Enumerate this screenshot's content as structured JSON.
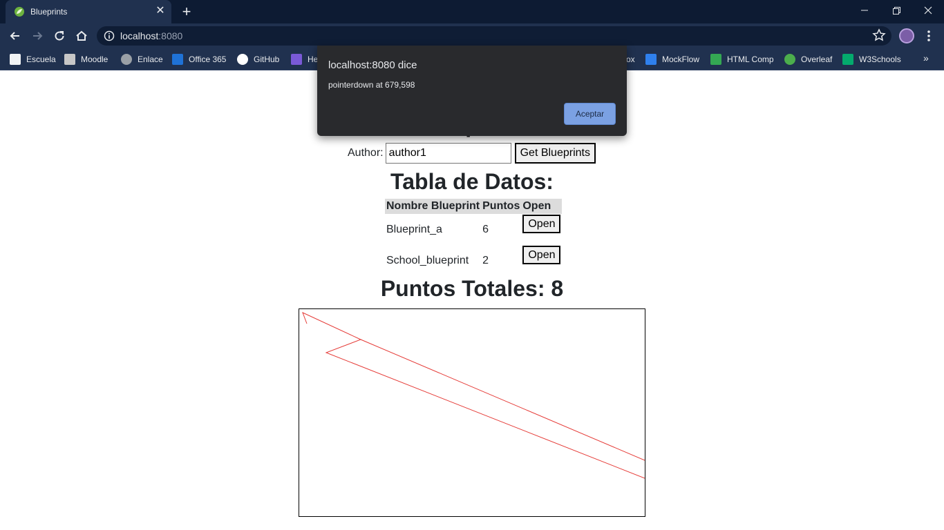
{
  "browser": {
    "tab_title": "Blueprints",
    "url_host": "localhost",
    "url_port": ":8080",
    "bookmarks": [
      {
        "label": "Escuela",
        "icon": "notebook-icon",
        "color": "#f1f3f4"
      },
      {
        "label": "Moodle",
        "icon": "moodle-icon",
        "color": "#c7c7c7"
      },
      {
        "label": "Enlace",
        "icon": "globe-icon",
        "color": "#9aa0a6"
      },
      {
        "label": "Office 365",
        "icon": "office-icon",
        "color": "#1f72d6"
      },
      {
        "label": "GitHub",
        "icon": "github-icon",
        "color": "#ffffff"
      },
      {
        "label": "He",
        "icon": "heroku-icon",
        "color": "#7a5ad7"
      },
      {
        "label": "ox",
        "icon": "dropbox-icon",
        "color": "#20314f"
      },
      {
        "label": "MockFlow",
        "icon": "mockflow-icon",
        "color": "#2f80ed"
      },
      {
        "label": "HTML Comp",
        "icon": "code-icon",
        "color": "#34a853"
      },
      {
        "label": "Overleaf",
        "icon": "overleaf-icon",
        "color": "#4cae4c"
      },
      {
        "label": "W3Schools",
        "icon": "w3schools-icon",
        "color": "#04aa6d"
      }
    ],
    "more_bookmarks": "»"
  },
  "page": {
    "author_label": "Author:",
    "author_value": "author1",
    "get_button": "Get Blueprints",
    "table_title": "Tabla de Datos:",
    "columns": [
      "Nombre Blueprint",
      "Puntos",
      "Open"
    ],
    "rows": [
      {
        "name": "Blueprint_a",
        "points": "6",
        "button": "Open"
      },
      {
        "name": "School_blueprint",
        "points": "2",
        "button": "Open"
      }
    ],
    "totals": "Puntos Totales: 8",
    "heading_visible": "Blueprints",
    "drawing_color": "#e53935"
  },
  "dialog": {
    "title": "localhost:8080 dice",
    "message": "pointerdown at 679,598",
    "ok_label": "Aceptar"
  }
}
